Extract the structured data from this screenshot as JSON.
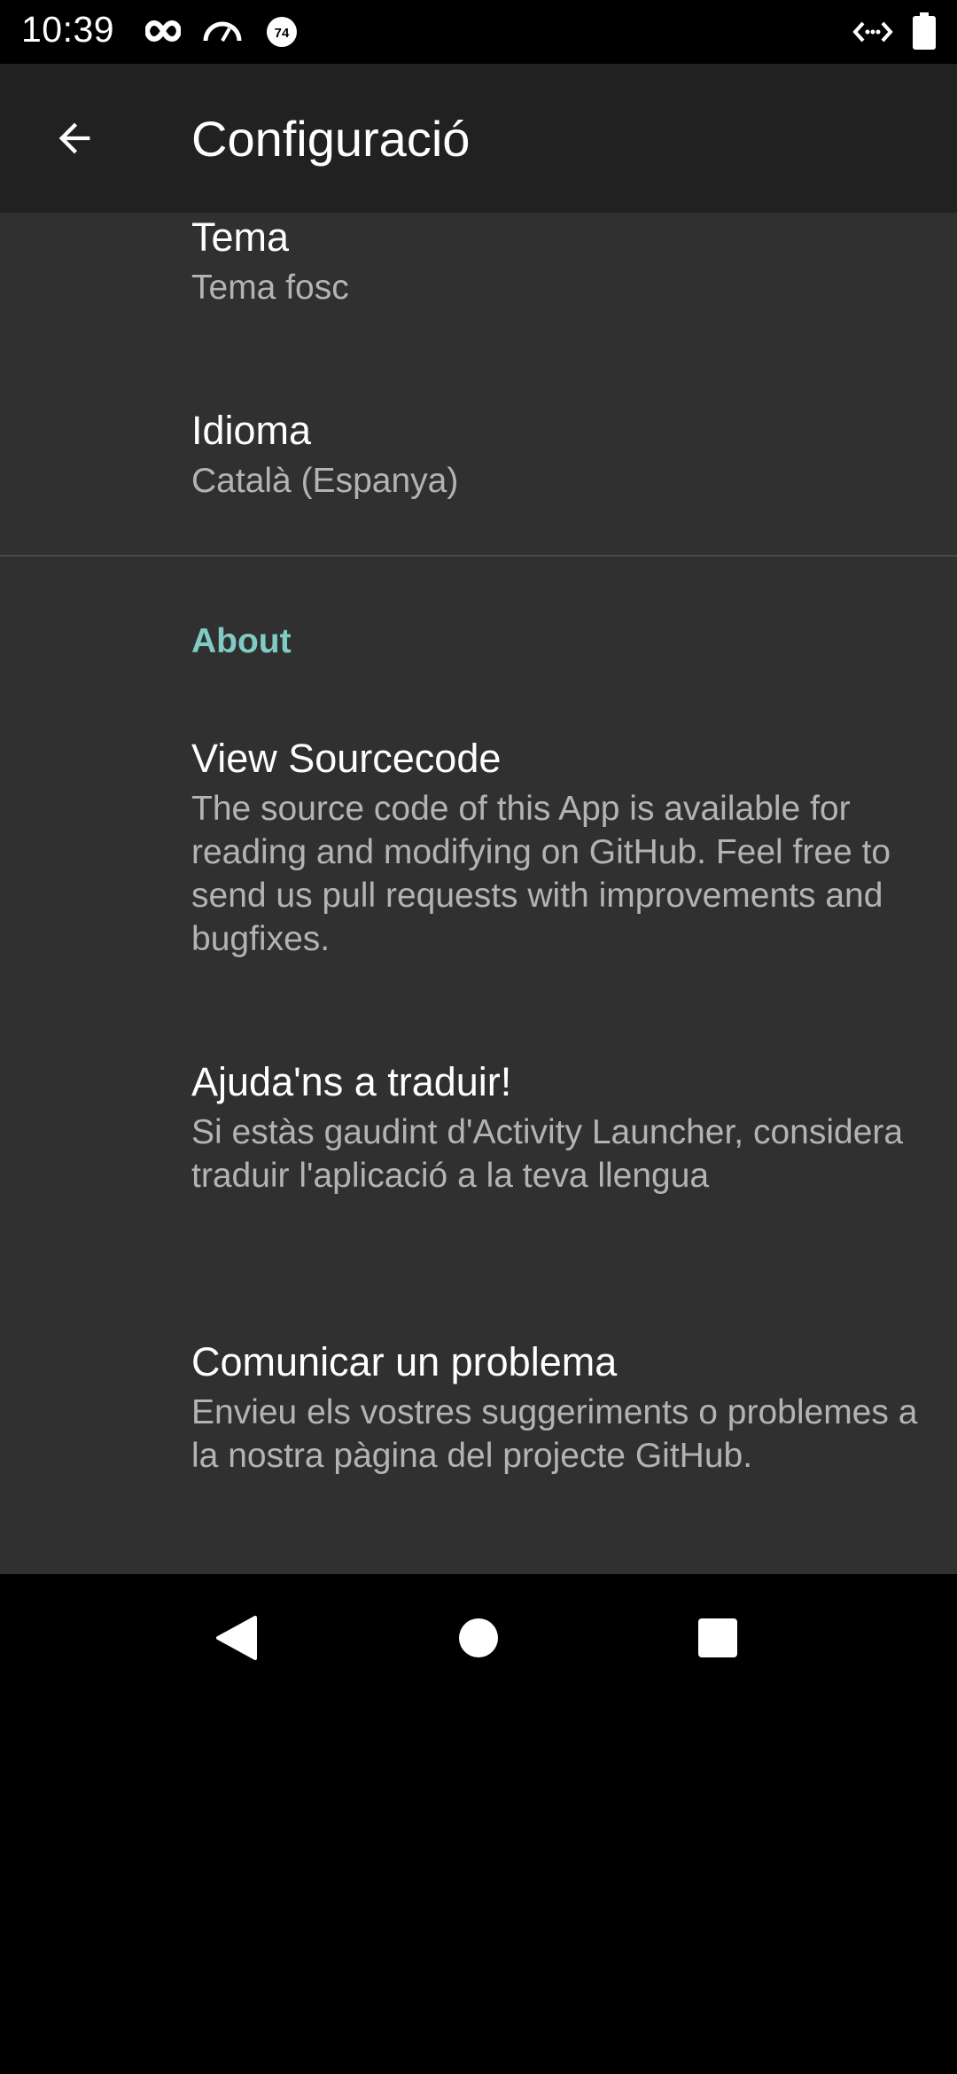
{
  "status_bar": {
    "time": "10:39",
    "badge": "74",
    "left_icons": [
      "infinity-icon",
      "speedometer-icon",
      "badge-icon"
    ],
    "right_icons": [
      "code-arrows-icon",
      "battery-icon"
    ]
  },
  "toolbar": {
    "title": "Configuració",
    "back_icon": "arrow-back-icon"
  },
  "prefs": {
    "theme": {
      "title": "Tema",
      "summary": "Tema fosc"
    },
    "language": {
      "title": "Idioma",
      "summary": "Català (Espanya)"
    },
    "about_category": "About",
    "source": {
      "title": "View Sourcecode",
      "summary": "The source code of this App is available for reading and modifying on GitHub. Feel free to send us pull requests with improvements and bugfixes."
    },
    "translate": {
      "title": "Ajuda'ns a traduir!",
      "summary": "Si estàs gaudint d'Activity Launcher, considera traduir l'aplicació a la teva llengua"
    },
    "report": {
      "title": "Comunicar un problema",
      "summary": "Envieu els vostres suggeriments o problemes a la nostra pàgina del projecte GitHub."
    }
  },
  "nav_bar": {
    "icons": [
      "back-triangle-icon",
      "home-circle-icon",
      "recents-square-icon"
    ]
  },
  "colors": {
    "toolbar": "#212121",
    "content": "#303030",
    "accent": "#80cbc4",
    "summary": "#b3b3b3"
  }
}
